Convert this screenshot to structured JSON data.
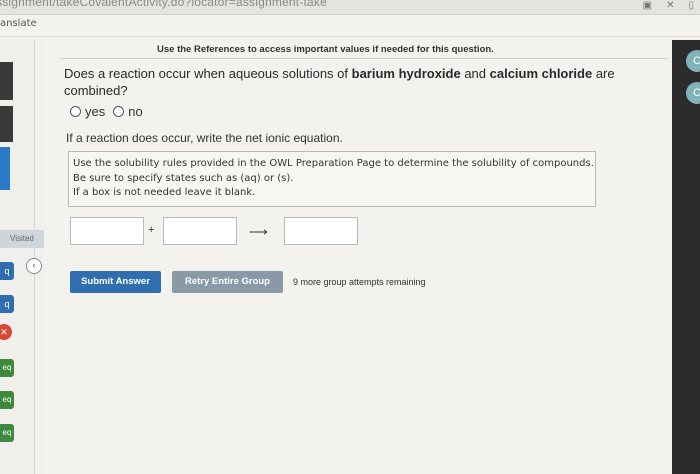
{
  "browser": {
    "url": "ssignment/takeCovalentActivity.do?locator=assignment-take",
    "translate_label": "anslate"
  },
  "sidebar": {
    "visited_label": "Visited",
    "tabs": [
      {
        "label": "q",
        "kind": "blue"
      },
      {
        "label": "q",
        "kind": "blue"
      },
      {
        "label": "✕",
        "kind": "error"
      },
      {
        "label": "eq",
        "kind": "green"
      },
      {
        "label": "eq",
        "kind": "green"
      },
      {
        "label": "eq",
        "kind": "green"
      }
    ],
    "collapse_icon": "chevron-left-icon"
  },
  "question": {
    "references": "Use the References to access important values if needed for this question.",
    "text_pre": "Does a reaction occur when aqueous solutions of ",
    "reactant1": "barium hydroxide",
    "text_mid": " and ",
    "reactant2": "calcium chloride",
    "text_post": " are combined?",
    "options": [
      "yes",
      "no"
    ],
    "if_reaction": "If a reaction does occur, write the net ionic equation.",
    "instructions": [
      "Use the solubility rules provided in the OWL Preparation Page to determine the solubility of compounds.",
      "Be sure to specify states such as (aq) or (s).",
      "If a box is not needed leave it blank."
    ],
    "plus_sign": "+",
    "arrow_sign": "⟶"
  },
  "actions": {
    "submit_label": "Submit Answer",
    "retry_label": "Retry Entire Group",
    "remaining_text": "9 more group attempts remaining"
  },
  "colors": {
    "accent": "#2f6fb0",
    "retry": "#8a99a8",
    "error": "#d9473a",
    "success": "#3d8a3e"
  }
}
